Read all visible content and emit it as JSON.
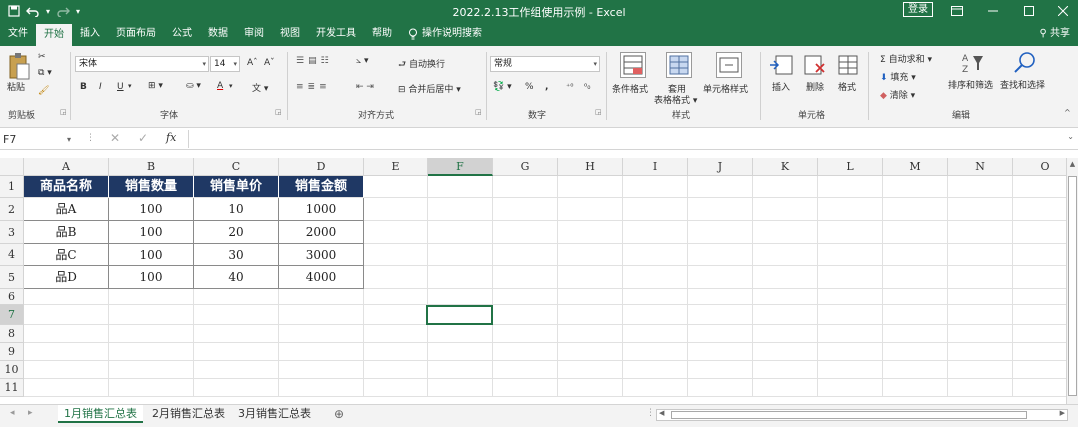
{
  "window": {
    "title": "2022.2.13工作组使用示例 - Excel",
    "login": "登录",
    "controls": [
      "restore-icon",
      "minimize-icon",
      "maximize-icon",
      "close-icon"
    ]
  },
  "qat": {
    "save": "💾",
    "undo": "↶",
    "redo": "↷"
  },
  "tabs": [
    "文件",
    "开始",
    "插入",
    "页面布局",
    "公式",
    "数据",
    "审阅",
    "视图",
    "开发工具",
    "帮助"
  ],
  "tab_active": "开始",
  "search": "操作说明搜索",
  "share": "共享",
  "ribbon": {
    "clipboard": {
      "paste": "粘贴",
      "label": "剪贴板"
    },
    "font": {
      "name": "宋体",
      "size": "14",
      "bold": "B",
      "italic": "I",
      "underline": "U",
      "grow": "A",
      "shrink": "A",
      "font_color": "A",
      "label": "字体"
    },
    "align": {
      "wrap": "自动换行",
      "merge": "合并后居中",
      "label": "对齐方式"
    },
    "number": {
      "format": "常规",
      "percent": "%",
      "comma": ",",
      "label": "数字"
    },
    "styles": {
      "cond": "条件格式",
      "table": "套用",
      "table2": "表格格式",
      "cell": "单元格样式",
      "label": "样式"
    },
    "cells": {
      "insert": "插入",
      "delete": "删除",
      "format": "格式",
      "label": "单元格"
    },
    "editing": {
      "autosum": "自动求和",
      "fill": "填充",
      "clear": "清除",
      "sort": "排序和筛选",
      "find": "查找和选择",
      "label": "编辑"
    }
  },
  "formula_bar": {
    "name_box": "F7",
    "fx": "fx",
    "value": ""
  },
  "columns": [
    "A",
    "B",
    "C",
    "D",
    "E",
    "F",
    "G",
    "H",
    "I",
    "J",
    "K",
    "L",
    "M",
    "N",
    "O"
  ],
  "selected_column": "F",
  "rows": [
    "1",
    "2",
    "3",
    "4",
    "5",
    "6",
    "7",
    "8",
    "9",
    "10",
    "11"
  ],
  "selected_row": "7",
  "table": {
    "headers": [
      "商品名称",
      "销售数量",
      "销售单价",
      "销售金额"
    ],
    "rows": [
      [
        "品A",
        "100",
        "10",
        "1000"
      ],
      [
        "品B",
        "100",
        "20",
        "2000"
      ],
      [
        "品C",
        "100",
        "30",
        "3000"
      ],
      [
        "品D",
        "100",
        "40",
        "4000"
      ]
    ]
  },
  "sheets": [
    "1月销售汇总表",
    "2月销售汇总表",
    "3月销售汇总表"
  ],
  "active_sheet": "1月销售汇总表",
  "colors": {
    "excel_green": "#217346",
    "header_fill": "#1f3864"
  }
}
